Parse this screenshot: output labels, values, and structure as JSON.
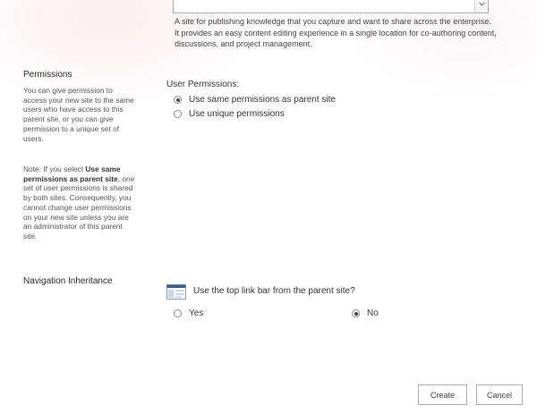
{
  "template": {
    "description": "A site for publishing knowledge that you capture and want to share across the enterprise. It provides an easy content editing experience in a single location for co-authoring content, discussions, and project management."
  },
  "permissions": {
    "title": "Permissions",
    "help_intro": "You can give permission to access your new site to the same users who have access to this parent site, or you can give permission to a unique set of users.",
    "help_note_prefix": "Note: If you select ",
    "help_note_bold": "Use same permissions as parent site",
    "help_note_suffix": ", one set of user permissions is shared by both sites. Consequently, you cannot change user permissions on your new site unless you are an administrator of this parent site.",
    "field_label": "User Permissions:",
    "options": [
      {
        "label": "Use same permissions as parent site",
        "checked": true
      },
      {
        "label": "Use unique permissions",
        "checked": false
      }
    ]
  },
  "navigation": {
    "title": "Navigation Inheritance",
    "question": "Use the top link bar from the parent site?",
    "icon": "top-link-bar-icon",
    "options": [
      {
        "label": "Yes",
        "checked": false
      },
      {
        "label": "No",
        "checked": true
      }
    ]
  },
  "buttons": {
    "create": "Create",
    "cancel": "Cancel"
  }
}
